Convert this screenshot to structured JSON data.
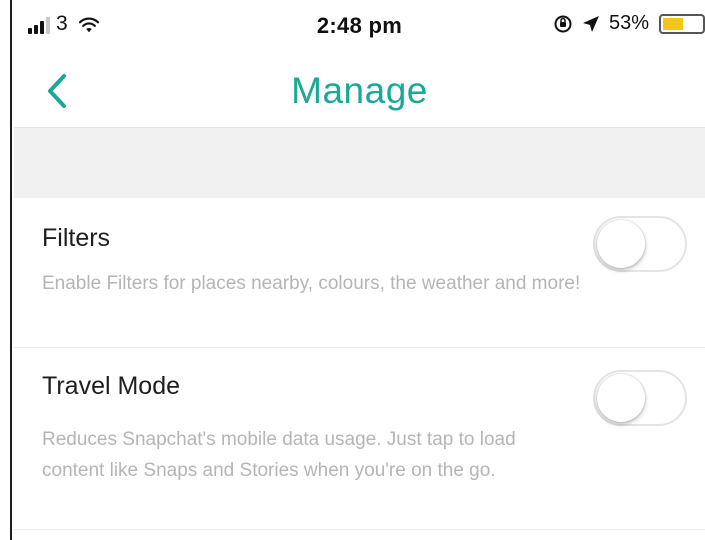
{
  "status_bar": {
    "carrier": "3",
    "time": "2:48 pm",
    "battery_percent_label": "53%",
    "battery_level": 0.53,
    "battery_color": "#f5c518",
    "icons": [
      "signal-icon",
      "wifi-icon",
      "orientation-lock-icon",
      "location-arrow-icon",
      "battery-icon"
    ]
  },
  "nav": {
    "title": "Manage",
    "accent_color": "#1aa996",
    "back_icon": "chevron-left-icon"
  },
  "settings": [
    {
      "title": "Filters",
      "description": "Enable Filters for places nearby, colours, the weather and more!",
      "enabled": false
    },
    {
      "title": "Travel Mode",
      "description": "Reduces Snapchat's mobile data usage. Just tap to load content like Snaps and Stories when you're on the go.",
      "enabled": false
    }
  ]
}
